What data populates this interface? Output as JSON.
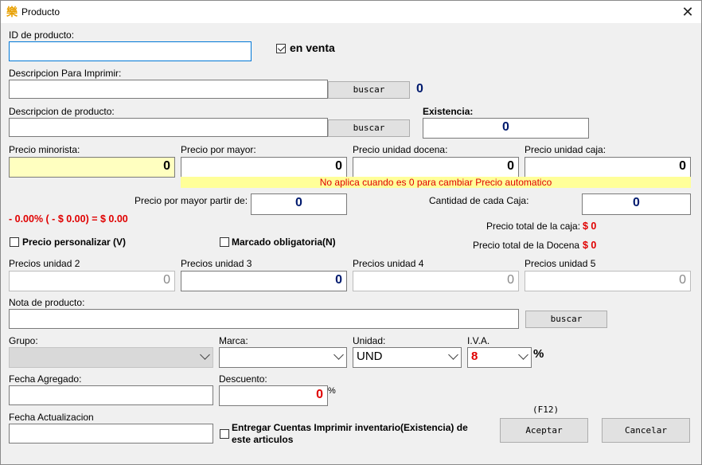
{
  "window": {
    "title": "Producto",
    "icon": "樂",
    "close": "✕"
  },
  "id_label": "ID de producto:",
  "en_venta": {
    "label": "en venta",
    "checked": true
  },
  "desc_imprimir_label": "Descripcion Para Imprimir:",
  "buscar_label": "buscar",
  "desc_imprimir_count": "0",
  "desc_producto_label": "Descripcion de producto:",
  "existencia": {
    "label": "Existencia:",
    "value": "0"
  },
  "precios": {
    "minorista": {
      "label": "Precio minorista:",
      "value": "0"
    },
    "mayor": {
      "label": "Precio por mayor:",
      "value": "0"
    },
    "docena": {
      "label": "Precio unidad docena:",
      "value": "0"
    },
    "caja": {
      "label": "Precio unidad caja:",
      "value": "0"
    }
  },
  "notice": "No aplica cuando es 0  para cambiar Precio automatico",
  "mayor_partir": {
    "label": "Precio por mayor partir de:",
    "value": "0"
  },
  "cantidad_caja": {
    "label": "Cantidad de cada Caja:",
    "value": "0"
  },
  "formula": "- 0.00% ( - $ 0.00) = $ 0.00",
  "total_caja": {
    "label": "Precio total de la caja:",
    "value": "$ 0"
  },
  "total_docena": {
    "label": "Precio total de la Docena",
    "value": "$ 0"
  },
  "precio_personalizar": "Precio personalizar (V)",
  "marcado_obligatoria": "Marcado obligatoria(N)",
  "unidades": [
    {
      "label": "Precios unidad 2",
      "value": "0"
    },
    {
      "label": "Precios unidad 3",
      "value": "0"
    },
    {
      "label": "Precios unidad 4",
      "value": "0"
    },
    {
      "label": "Precios unidad 5",
      "value": "0"
    }
  ],
  "nota_label": "Nota de producto:",
  "grupo_label": "Grupo:",
  "marca_label": "Marca:",
  "unidad": {
    "label": "Unidad:",
    "value": "UND"
  },
  "iva": {
    "label": "I.V.A.",
    "value": "8",
    "suffix": "%"
  },
  "fecha_agregado_label": "Fecha Agregado:",
  "descuento": {
    "label": "Descuento:",
    "value": "0",
    "suffix": "%"
  },
  "fecha_actualizacion_label": "Fecha Actualizacion",
  "entregar_line1": "Entregar Cuentas Imprimir inventario(Existencia) de",
  "entregar_line2": "este articulos",
  "shortcut": "(F12)",
  "aceptar": "Aceptar",
  "cancelar": "Cancelar",
  "colors": {
    "accent": "#0078d7",
    "red": "#e00000",
    "navy": "#001a6e",
    "highlight": "#ffff99"
  }
}
